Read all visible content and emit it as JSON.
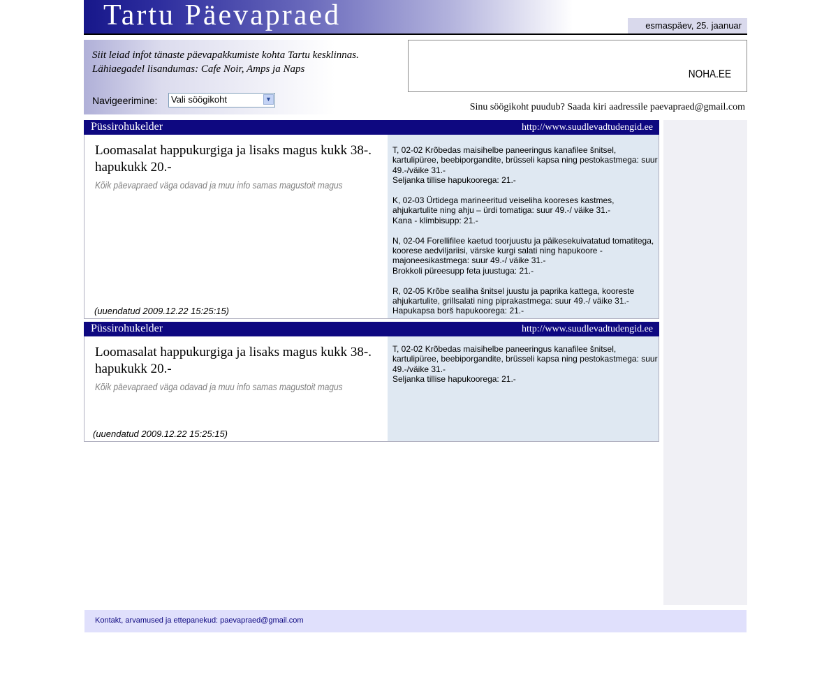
{
  "site": {
    "title": "Tartu Päevapraed",
    "date": "esmaspäev, 25. jaanuar"
  },
  "intro": {
    "line1": "Siit leiad infot tänaste päevapakkumiste kohta Tartu kesklinnas.",
    "line2": "Lähiaegadel lisandumas: Cafe Noir, Amps ja Naps"
  },
  "navigation": {
    "label": "Navigeerimine:",
    "selected": "Vali söögikoht"
  },
  "ad": {
    "text": "NOHA.EE"
  },
  "missing": "Sinu söögikoht puudub? Saada kiri aadressile paevapraed@gmail.com",
  "cards": [
    {
      "title": "Püssirohukelder",
      "url": "http://www.suudlevadtudengid.ee",
      "special": "Loomasalat happukurgiga ja lisaks magus kukk 38-. hapukukk 20.-",
      "note": "Kõik päevapraed väga odavad ja muu info samas magustoit magus",
      "updated": "(uuendatud 2009.12.22 15:25:15)",
      "menu": [
        "T, 02-02 Krõbedas maisihelbe paneeringus kanafilee šnitsel, kartulipüree, beebiporgandite, brüsseli kapsa ning pestokastmega: suur 49.-/väike 31.-\nSeljanka tillise hapukoorega: 21.-",
        "K, 02-03 Ürtidega marineeritud veiseliha kooreses kastmes, ahjukartulite ning ahju – ürdi tomatiga: suur 49.-/ väike 31.-\nKana - klimbisupp: 21.-",
        "N, 02-04 Forellifilee kaetud toorjuustu ja päikesekuivatatud tomatitega, koorese aedviljariisi, värske kurgi salati ning hapukoore - majoneesikastmega: suur 49.-/ väike 31.-\nBrokkoli püreesupp feta juustuga: 21.-",
        "R, 02-05 Krõbe sealiha šnitsel juustu ja paprika kattega, kooreste ahjukartulite, grillsalati ning piprakastmega: suur 49.-/ väike 31.-\nHapukapsa borš hapukoorega: 21.-"
      ]
    },
    {
      "title": "Püssirohukelder",
      "url": "http://www.suudlevadtudengid.ee",
      "special": "Loomasalat happukurgiga ja lisaks magus kukk 38-. hapukukk 20.-",
      "note": "Kõik päevapraed väga odavad ja muu info samas magustoit magus",
      "updated": "(uuendatud 2009.12.22 15:25:15)",
      "menu": [
        "T, 02-02 Krõbedas maisihelbe paneeringus kanafilee šnitsel, kartulipüree, beebiporgandite, brüsseli kapsa ning pestokastmega: suur 49.-/väike 31.-\nSeljanka tillise hapukoorega: 21.-"
      ]
    }
  ],
  "footer": {
    "text": "Kontakt, arvamused ja ettepanekud: paevapraed@gmail.com"
  }
}
